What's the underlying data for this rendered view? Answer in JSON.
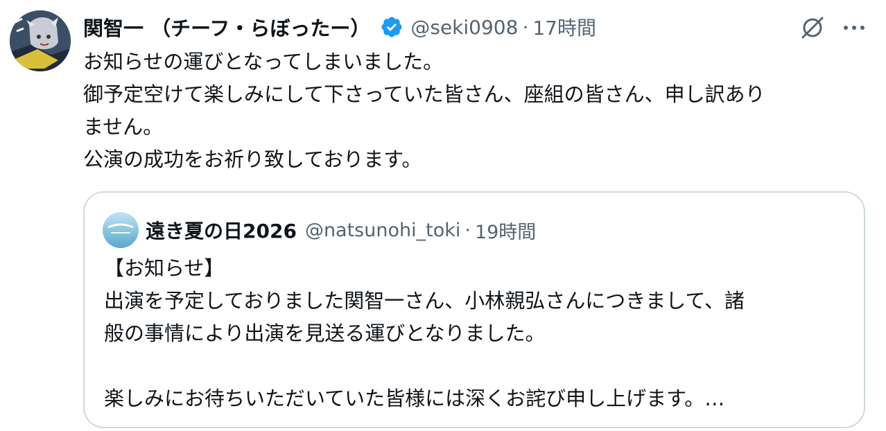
{
  "colors": {
    "text_primary": "#0f1419",
    "text_secondary": "#536471",
    "verified_badge": "#1d9bf0",
    "border": "#cfd9de"
  },
  "tweet": {
    "author": {
      "display_name": "関智一 （チーフ・らぼったー）",
      "handle": "@seki0908",
      "avatar_icon": "user-avatar-icon",
      "verified_icon": "verified-badge-icon"
    },
    "separator": "·",
    "time": "17時間",
    "actions": {
      "grok_icon": "grok-icon",
      "more_icon": "more-options-icon"
    },
    "text_lines": [
      "お知らせの運びとなってしまいました。",
      "御予定空けて楽しみにして下さっていた皆さん、座組の皆さん、申し訳あり",
      "ません。",
      "公演の成功をお祈り致しております。"
    ]
  },
  "quote": {
    "author": {
      "display_name": "遠き夏の日2026",
      "handle": "@natsunohi_toki",
      "avatar_icon": "quote-avatar-icon"
    },
    "separator": "·",
    "time": "19時間",
    "text_lines": [
      "【お知らせ】",
      "出演を予定しておりました関智一さん、小林親弘さんにつきまして、諸",
      "般の事情により出演を見送る運びとなりました。",
      "",
      "楽しみにお待ちいただいていた皆様には深くお詫び申し上げます。…"
    ]
  }
}
